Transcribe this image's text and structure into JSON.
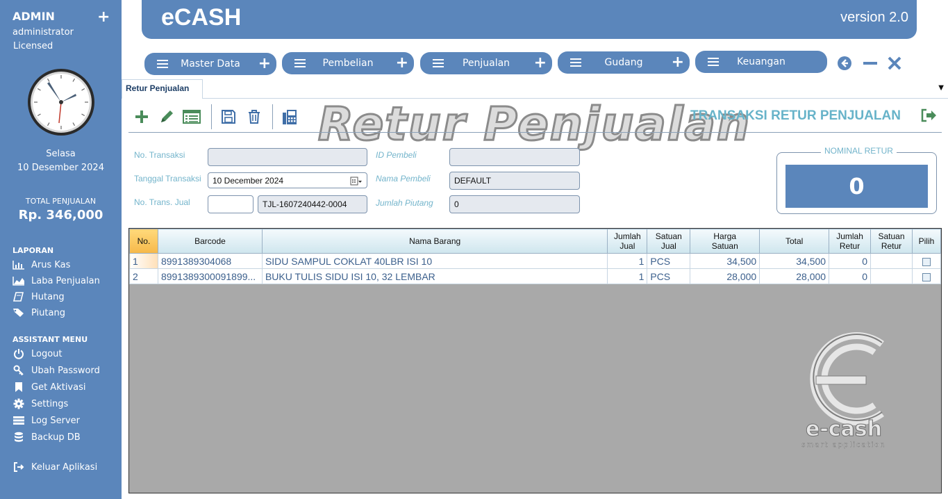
{
  "sidebar": {
    "user": "ADMIN",
    "role": "administrator",
    "license": "Licensed",
    "day": "Selasa",
    "date": "10 Desember 2024",
    "total_label": "TOTAL PENJUALAN",
    "total_value": "Rp. 346,000",
    "laporan_head": "LAPORAN",
    "laporan": [
      {
        "label": "Arus Kas",
        "icon": "bar-chart-icon"
      },
      {
        "label": "Laba Penjualan",
        "icon": "area-chart-icon"
      },
      {
        "label": "Hutang",
        "icon": "book-icon"
      },
      {
        "label": "Piutang",
        "icon": "tags-icon"
      }
    ],
    "assistant_head": "ASSISTANT MENU",
    "assistant": [
      {
        "label": "Logout",
        "icon": "power-icon"
      },
      {
        "label": "Ubah Password",
        "icon": "key-icon"
      },
      {
        "label": "Get Aktivasi",
        "icon": "bookmark-icon"
      },
      {
        "label": "Settings",
        "icon": "gear-icon"
      },
      {
        "label": "Log Server",
        "icon": "list-icon"
      },
      {
        "label": "Backup DB",
        "icon": "database-icon"
      }
    ],
    "exit": {
      "label": "Keluar Aplikasi",
      "icon": "sign-out-icon"
    }
  },
  "header": {
    "title": "eCASH",
    "version": "version 2.0"
  },
  "menu": [
    {
      "label": "Master Data"
    },
    {
      "label": "Pembelian"
    },
    {
      "label": "Penjualan"
    },
    {
      "label": "Gudang"
    },
    {
      "label": "Keuangan"
    }
  ],
  "tab": {
    "label": "Retur Penjualan"
  },
  "toolbar": {
    "watermark": "Retur Penjualan",
    "title": "TRANSAKSI RETUR PENJUALAN",
    "icons": [
      "add-icon",
      "edit-icon",
      "list-icon",
      "save-icon",
      "delete-icon",
      "print-icon"
    ]
  },
  "form": {
    "no_transaksi_label": "No. Transaksi",
    "no_transaksi_value": "",
    "tanggal_label": "Tanggal Transaksi",
    "tanggal_value": "10 December 2024",
    "no_trans_jual_label": "No. Trans. Jual",
    "no_trans_jual_code": "",
    "no_trans_jual_value": "TJL-1607240442-0004",
    "id_pembeli_label": "ID Pembeli",
    "id_pembeli_value": "",
    "nama_pembeli_label": "Nama Pembeli",
    "nama_pembeli_value": "DEFAULT",
    "jumlah_piutang_label": "Jumlah Piutang",
    "jumlah_piutang_value": "0"
  },
  "nominal": {
    "label": "NOMINAL RETUR",
    "value": "0"
  },
  "table": {
    "headers": {
      "no": "No.",
      "barcode": "Barcode",
      "nama": "Nama Barang",
      "jumlah_jual_1": "Jumlah",
      "jumlah_jual_2": "Jual",
      "satuan_jual_1": "Satuan",
      "satuan_jual_2": "Jual",
      "harga_1": "Harga",
      "harga_2": "Satuan",
      "total": "Total",
      "jumlah_retur_1": "Jumlah",
      "jumlah_retur_2": "Retur",
      "satuan_retur_1": "Satuan",
      "satuan_retur_2": "Retur",
      "pilih": "Pilih"
    },
    "rows": [
      {
        "no": "1",
        "barcode": "8991389304068",
        "nama": "SIDU SAMPUL COKLAT 40LBR ISI 10",
        "jumlah_jual": "1",
        "satuan_jual": "PCS",
        "harga": "34,500",
        "total": "34,500",
        "jumlah_retur": "0",
        "satuan_retur": ""
      },
      {
        "no": "2",
        "barcode": "8991389300091899...",
        "nama": "BUKU TULIS SIDU ISI 10, 32 LEMBAR",
        "jumlah_jual": "1",
        "satuan_jual": "PCS",
        "harga": "28,000",
        "total": "28,000",
        "jumlah_retur": "0",
        "satuan_retur": ""
      }
    ]
  },
  "logo": {
    "text": "e-cash",
    "tagline": "smart application"
  }
}
